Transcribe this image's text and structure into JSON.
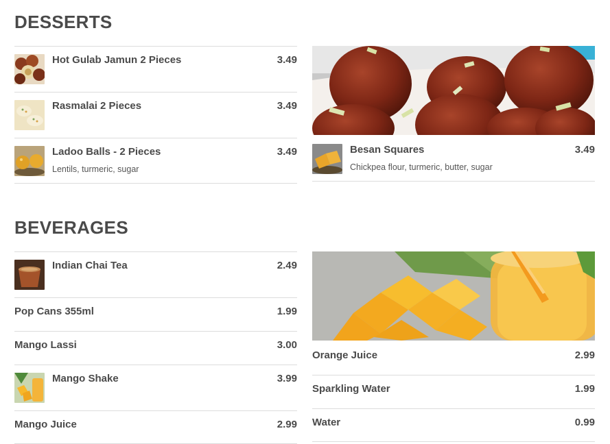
{
  "desserts": {
    "title": "DESSERTS",
    "left_items": [
      {
        "name": "Hot Gulab Jamun 2 Pieces",
        "price": "3.49",
        "desc": "",
        "thumb": "gulab-jamun-thumbnail"
      },
      {
        "name": "Rasmalai 2 Pieces",
        "price": "3.49",
        "desc": "",
        "thumb": "rasmalai-thumbnail"
      },
      {
        "name": "Ladoo Balls - 2 Pieces",
        "price": "3.49",
        "desc": "Lentils, turmeric, sugar",
        "thumb": "ladoo-thumbnail"
      }
    ],
    "right_items": [
      {
        "name": "Besan Squares",
        "price": "3.49",
        "desc": "Chickpea flour, turmeric, butter, sugar",
        "thumb": "besan-thumbnail"
      }
    ]
  },
  "beverages": {
    "title": "BEVERAGES",
    "left_items": [
      {
        "name": "Indian Chai Tea",
        "price": "2.49",
        "thumb": "chai-thumbnail"
      },
      {
        "name": "Pop Cans 355ml",
        "price": "1.99"
      },
      {
        "name": "Mango Lassi",
        "price": "3.00"
      },
      {
        "name": "Mango Shake",
        "price": "3.99",
        "thumb": "mango-shake-thumbnail"
      },
      {
        "name": "Mango Juice",
        "price": "2.99"
      }
    ],
    "right_items": [
      {
        "name": "Orange Juice",
        "price": "2.99"
      },
      {
        "name": "Sparkling Water",
        "price": "1.99"
      },
      {
        "name": "Water",
        "price": "0.99"
      }
    ]
  }
}
